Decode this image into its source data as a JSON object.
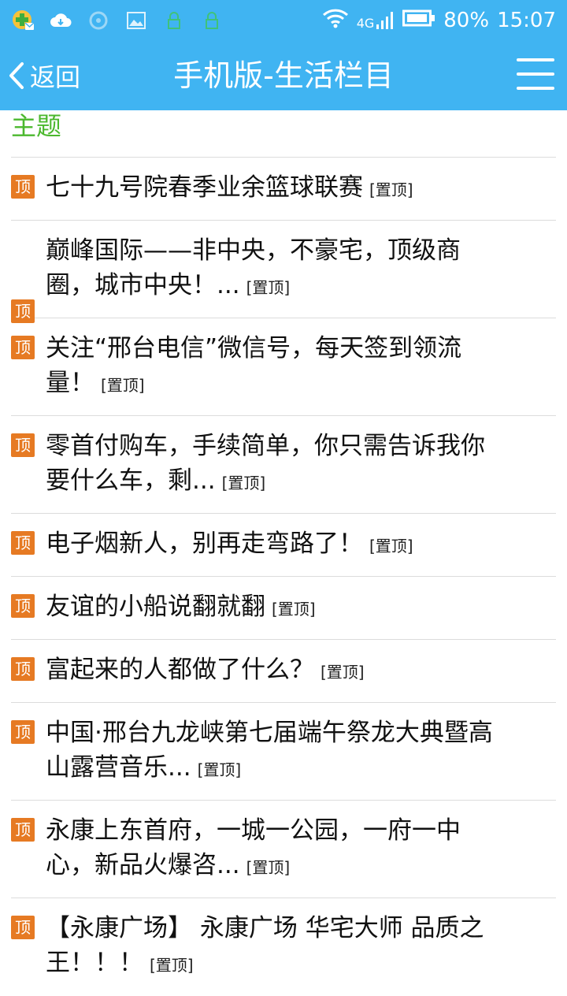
{
  "status_bar": {
    "battery": "80%",
    "time": "15:07",
    "network": "4G",
    "icons": [
      "app-logo-icon",
      "cloud-download-icon",
      "circle-icon",
      "image-icon",
      "lock-icon",
      "lock-icon",
      "wifi-icon",
      "signal-icon",
      "battery-icon"
    ]
  },
  "nav": {
    "back_label": "返回",
    "title": "手机版-生活栏目",
    "menu_icon": "hamburger-menu-icon"
  },
  "section": {
    "title": "主题"
  },
  "colors": {
    "header": "#40b4f2",
    "badge": "#e67a23",
    "section": "#4bb82e"
  },
  "list": {
    "badge": "顶",
    "tag": "[置顶]",
    "items": [
      {
        "line1": "七十九号院春季业余篮球联赛",
        "line2": ""
      },
      {
        "line1": "巅峰国际——非中央，不豪宅，顶级商",
        "line2": "圈，城市中央！..."
      },
      {
        "line1": "关注“邢台电信”微信号，每天签到领流",
        "line2": "量！"
      },
      {
        "line1": "零首付购车，手续简单，你只需告诉我你",
        "line2": "要什么车，剩..."
      },
      {
        "line1": "电子烟新人，别再走弯路了！",
        "line2": ""
      },
      {
        "line1": "友谊的小船说翻就翻",
        "line2": ""
      },
      {
        "line1": "富起来的人都做了什么？",
        "line2": ""
      },
      {
        "line1": "中国·邢台九龙峡第七届端午祭龙大典暨高",
        "line2": "山露营音乐..."
      },
      {
        "line1": "永康上东首府，一城一公园，一府一中",
        "line2": "心，新品火爆咨..."
      },
      {
        "line1": "【永康广场】 永康广场 华宅大师 品质之",
        "line2": "王！！！"
      }
    ]
  }
}
